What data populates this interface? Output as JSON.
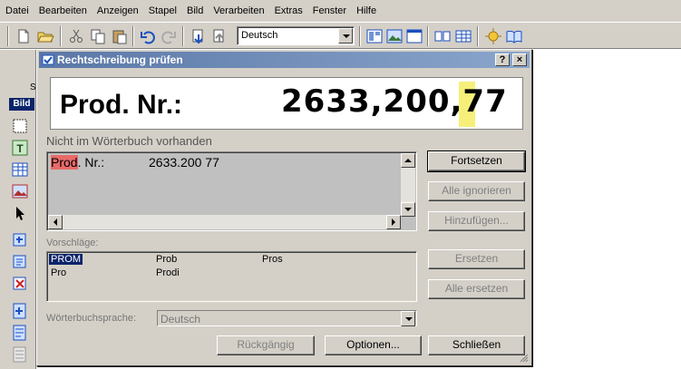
{
  "menu": [
    {
      "label": "Datei"
    },
    {
      "label": "Bearbeiten"
    },
    {
      "label": "Anzeigen"
    },
    {
      "label": "Stapel"
    },
    {
      "label": "Bild"
    },
    {
      "label": "Verarbeiten"
    },
    {
      "label": "Extras"
    },
    {
      "label": "Fenster"
    },
    {
      "label": "Hilfe"
    }
  ],
  "toolbar": {
    "language_value": "Deutsch",
    "icons": [
      "new-document-icon",
      "open-folder-icon",
      "cut-icon",
      "copy-icon",
      "paste-icon",
      "undo-icon",
      "redo-icon",
      "import-icon",
      "export-icon",
      "layout-icon",
      "image-icon",
      "window-icon",
      "two-pages-icon",
      "grid-icon",
      "wizard-icon",
      "help-book-icon"
    ]
  },
  "sidebar": {
    "partial_label": "S",
    "active_label": "Bild",
    "tools": [
      "select-area-icon",
      "text-area-icon",
      "table-area-icon",
      "picture-area-icon",
      "pointer-icon",
      "zone-add-icon",
      "zone-order-icon",
      "zone-delete-icon",
      "page-add-icon",
      "page-edit-icon",
      "page-list-icon"
    ]
  },
  "dialog": {
    "title": "Rechtschreibung prüfen",
    "help_button": "?",
    "close_button": "×",
    "preview": {
      "label_text": "Prod. Nr.:",
      "number_text": "2633,200,77"
    },
    "not_in_dictionary_label": "Nicht im Wörterbuch vorhanden",
    "text": {
      "error_word": "Prod",
      "rest": ". Nr.:",
      "number": "2633.200 77"
    },
    "suggestions_label": "Vorschläge:",
    "suggestions": [
      {
        "text": "PROM",
        "selected": true
      },
      {
        "text": "Prob",
        "selected": false
      },
      {
        "text": "Pros",
        "selected": false
      },
      {
        "text": "Pro",
        "selected": false
      },
      {
        "text": "Prodi",
        "selected": false
      }
    ],
    "dictionary_language_label": "Wörterbuchsprache:",
    "dictionary_language_value": "Deutsch",
    "buttons": {
      "continue": "Fortsetzen",
      "ignore_all": "Alle ignorieren",
      "add": "Hinzufügen...",
      "replace": "Ersetzen",
      "replace_all": "Alle ersetzen",
      "undo": "Rückgängig",
      "options": "Optionen...",
      "close": "Schließen"
    }
  },
  "colors": {
    "chrome": "#d4d0c8",
    "titlebar_start": "#5a77a7",
    "titlebar_end": "#8aa6cc",
    "selection": "#0a246a",
    "error_highlight": "#e86a6a",
    "preview_highlight": "#f6f07a"
  }
}
